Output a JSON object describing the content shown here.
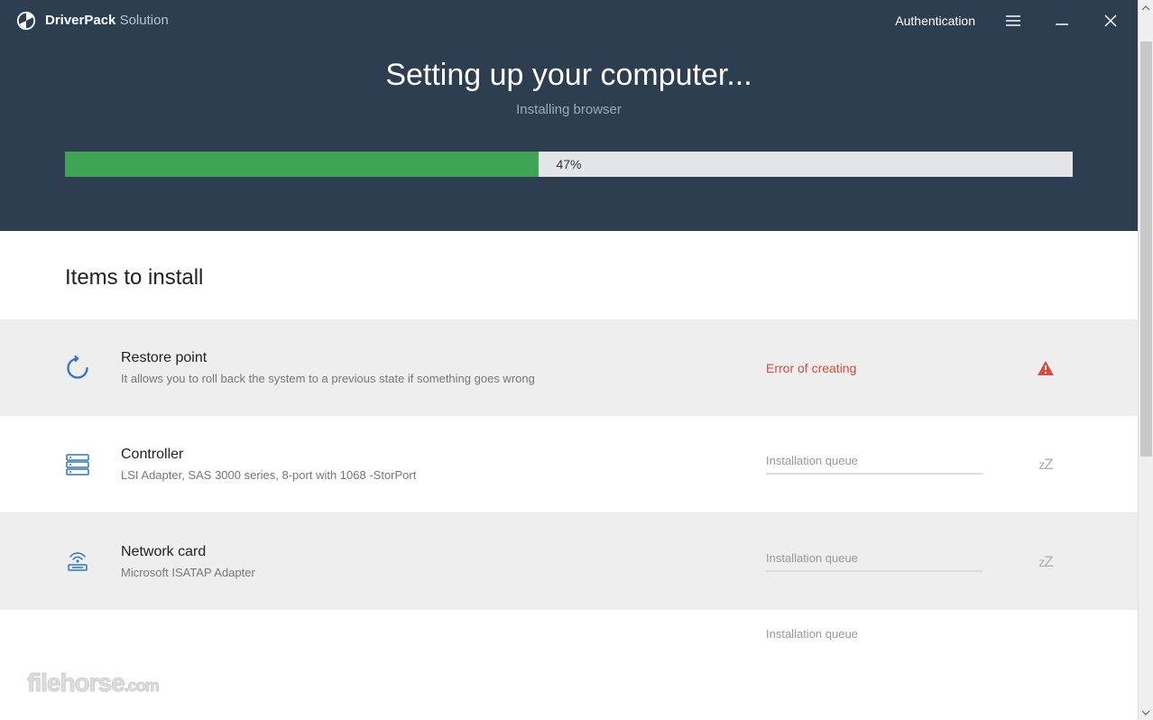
{
  "titlebar": {
    "brand_strong": "DriverPack",
    "brand_light": " Solution",
    "auth": "Authentication"
  },
  "header": {
    "title": "Setting up your computer...",
    "subtitle": "Installing browser"
  },
  "progress": {
    "value": 47,
    "label": "47%"
  },
  "section_title": "Items to install",
  "items": [
    {
      "name": "Restore point",
      "desc": "It allows you to roll back the system to a previous state if something goes wrong",
      "status_type": "error",
      "status_text": "Error of creating"
    },
    {
      "name": "Controller",
      "desc": "LSI Adapter, SAS 3000 series, 8-port with 1068 -StorPort",
      "status_type": "queue",
      "status_text": "Installation queue"
    },
    {
      "name": "Network card",
      "desc": "Microsoft ISATAP Adapter",
      "status_type": "queue",
      "status_text": "Installation queue"
    }
  ],
  "partial_item": {
    "status_text": "Installation queue"
  },
  "watermark": {
    "main": "filehorse",
    "suffix": ".com"
  }
}
